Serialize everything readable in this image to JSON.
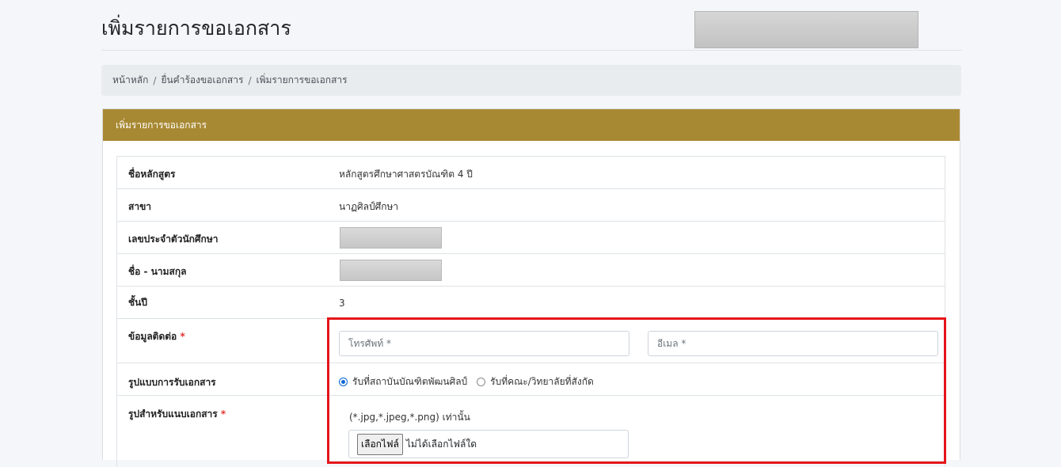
{
  "page": {
    "title": "เพิ่มรายการขอเอกสาร"
  },
  "breadcrumb": {
    "items": [
      "หน้าหลัก",
      "ยื่นคำร้องขอเอกสาร",
      "เพิ่มรายการขอเอกสาร"
    ],
    "separator": "/"
  },
  "card": {
    "header": "เพิ่มรายการขอเอกสาร"
  },
  "rows": {
    "program": {
      "label": "ชื่อหลักสูตร",
      "value": "หลักสูตรศึกษาศาสตรบัณฑิต 4 ปี"
    },
    "major": {
      "label": "สาขา",
      "value": "นาฏศิลป์ศึกษา"
    },
    "student_id": {
      "label": "เลขประจำตัวนักศึกษา"
    },
    "name": {
      "label": "ชื่อ - นามสกุล"
    },
    "year": {
      "label": "ชั้นปี",
      "value": "3"
    },
    "contact": {
      "label": "ข้อมูลติดต่อ",
      "required": "*",
      "phone_placeholder": "โทรศัพท์ *",
      "email_placeholder": "อีเมล *"
    },
    "delivery": {
      "label": "รูปแบบการรับเอกสาร",
      "options": [
        "รับที่สถาบันบัณฑิตพัฒนศิลป์",
        "รับที่คณะ/วิทยาลัยที่สังกัด"
      ],
      "selected": "รับที่สถาบันบัณฑิตพัฒนศิลป์"
    },
    "photo": {
      "label": "รูปสำหรับแนบเอกสาร",
      "required": "*",
      "hint": "(*.jpg,*.jpeg,*.png) เท่านั้น",
      "button": "เลือกไฟล์",
      "status": "ไม่ได้เลือกไฟล์ใด"
    }
  },
  "colors": {
    "header": "#a88933",
    "highlight": "#e4161b",
    "radio": "#0a66d6"
  }
}
